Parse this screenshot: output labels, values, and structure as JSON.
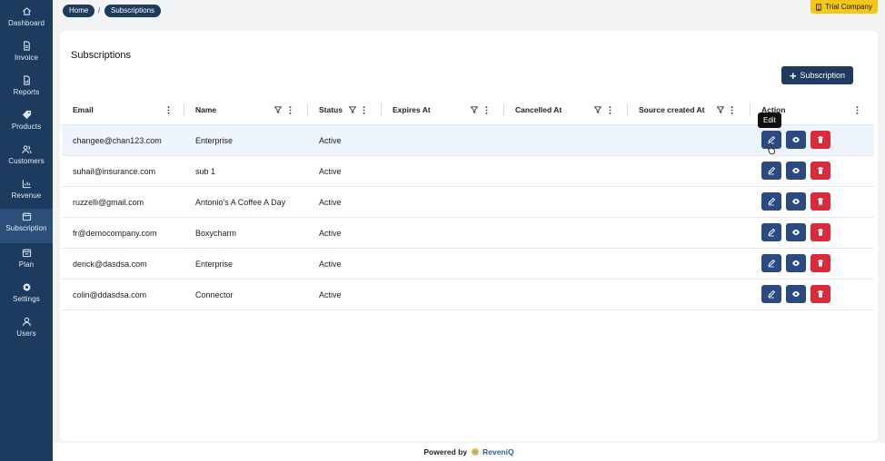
{
  "sidebar": {
    "items": [
      {
        "label": "Dashboard",
        "icon": "home-icon"
      },
      {
        "label": "Invoice",
        "icon": "invoice-icon"
      },
      {
        "label": "Reports",
        "icon": "reports-icon"
      },
      {
        "label": "Products",
        "icon": "tag-icon"
      },
      {
        "label": "Customers",
        "icon": "customers-icon"
      },
      {
        "label": "Revenue",
        "icon": "chart-icon"
      },
      {
        "label": "Subscription",
        "icon": "calendar-icon",
        "active": true
      },
      {
        "label": "Plan",
        "icon": "plan-icon"
      },
      {
        "label": "Settings",
        "icon": "gear-icon"
      },
      {
        "label": "Users",
        "icon": "user-icon"
      }
    ]
  },
  "breadcrumb": {
    "home": "Home",
    "separator": "/",
    "current": "Subscriptions"
  },
  "company_badge": "Trial Company",
  "page": {
    "title": "Subscriptions",
    "add_button": "Subscription"
  },
  "table": {
    "columns": [
      "Email",
      "Name",
      "Status",
      "Expires At",
      "Cancelled At",
      "Source created At",
      "Action"
    ],
    "rows": [
      {
        "email": "changee@chan123.com",
        "name": "Enterprise",
        "status": "Active",
        "expires_at": "",
        "cancelled_at": "",
        "source_created_at": ""
      },
      {
        "email": "suhail@insurance.com",
        "name": "sub 1",
        "status": "Active",
        "expires_at": "",
        "cancelled_at": "",
        "source_created_at": ""
      },
      {
        "email": "ruzzelli@gmail.com",
        "name": "Antonio's A Coffee A Day",
        "status": "Active",
        "expires_at": "",
        "cancelled_at": "",
        "source_created_at": ""
      },
      {
        "email": "fr@democompany.com",
        "name": "Boxycharm",
        "status": "Active",
        "expires_at": "",
        "cancelled_at": "",
        "source_created_at": ""
      },
      {
        "email": "derick@dasdsa.com",
        "name": "Enterprise",
        "status": "Active",
        "expires_at": "",
        "cancelled_at": "",
        "source_created_at": ""
      },
      {
        "email": "colin@ddasdsa.com",
        "name": "Connector",
        "status": "Active",
        "expires_at": "",
        "cancelled_at": "",
        "source_created_at": ""
      }
    ]
  },
  "tooltip": "Edit",
  "footer": {
    "prefix": "Powered by",
    "brand": "ReveniQ"
  },
  "colors": {
    "sidebar": "#1d3a5f",
    "primary": "#2b4a82",
    "danger": "#d92b3a",
    "badge": "#f5c518",
    "row_highlight": "#eef4fc"
  }
}
